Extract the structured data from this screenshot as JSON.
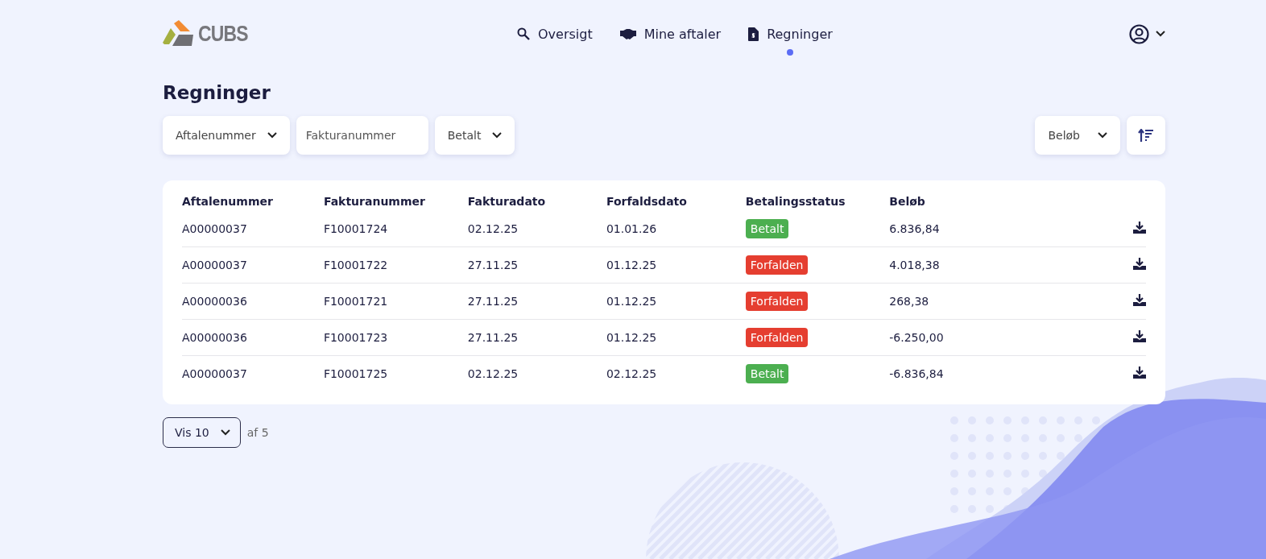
{
  "logo": {
    "text": "CUBS"
  },
  "nav": [
    {
      "label": "Oversigt",
      "selected": false
    },
    {
      "label": "Mine aftaler",
      "selected": false
    },
    {
      "label": "Regninger",
      "selected": true
    }
  ],
  "page_title": "Regninger",
  "filters": [
    {
      "kind": "dropdown",
      "label": "Aftalenummer"
    },
    {
      "kind": "input",
      "placeholder": "Fakturanummer"
    },
    {
      "kind": "dropdown",
      "label": "Betalt"
    }
  ],
  "sort": {
    "label": "Beløb"
  },
  "table": {
    "columns": [
      "Aftalenummer",
      "Fakturanummer",
      "Fakturadato",
      "Forfaldsdato",
      "Betalingsstatus",
      "Beløb"
    ],
    "rows": [
      {
        "agreement": "A00000037",
        "invoice": "F10001724",
        "invoice_date": "02.12.25",
        "due_date": "01.01.26",
        "status": {
          "label": "Betalt",
          "color": "#4caf50"
        },
        "amount": "6.836,84"
      },
      {
        "agreement": "A00000037",
        "invoice": "F10001722",
        "invoice_date": "27.11.25",
        "due_date": "01.12.25",
        "status": {
          "label": "Forfalden",
          "color": "#e53e30"
        },
        "amount": "4.018,38"
      },
      {
        "agreement": "A00000036",
        "invoice": "F10001721",
        "invoice_date": "27.11.25",
        "due_date": "01.12.25",
        "status": {
          "label": "Forfalden",
          "color": "#e53e30"
        },
        "amount": "268,38"
      },
      {
        "agreement": "A00000036",
        "invoice": "F10001723",
        "invoice_date": "27.11.25",
        "due_date": "01.12.25",
        "status": {
          "label": "Forfalden",
          "color": "#e53e30"
        },
        "amount": "-6.250,00"
      },
      {
        "agreement": "A00000037",
        "invoice": "F10001725",
        "invoice_date": "02.12.25",
        "due_date": "02.12.25",
        "status": {
          "label": "Betalt",
          "color": "#4caf50"
        },
        "amount": "-6.836,84"
      }
    ]
  },
  "pagination": {
    "page_size": "Vis 10",
    "total": "af 5"
  }
}
